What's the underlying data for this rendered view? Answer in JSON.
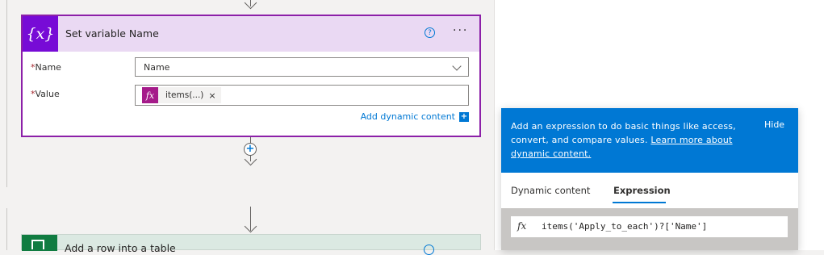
{
  "card": {
    "icon_text": "{x}",
    "title": "Set variable Name",
    "help_icon": "question-circle-icon",
    "more_label": "···",
    "name_label": "Name",
    "name_required": "*",
    "name_value": "Name",
    "value_label": "Value",
    "value_required": "*",
    "token": {
      "icon": "fx",
      "text": "items(...)",
      "remove": "×"
    },
    "add_dynamic_content": "Add dynamic content"
  },
  "next_card": {
    "title": "Add a row into a table"
  },
  "expression_panel": {
    "description": "Add an expression to do basic things like access, convert, and compare values. ",
    "link_text": "Learn more about dynamic content.",
    "hide_label": "Hide",
    "tabs": [
      {
        "label": "Dynamic content",
        "active": false
      },
      {
        "label": "Expression",
        "active": true
      }
    ],
    "fx_label": "fx",
    "expression": "items('Apply_to_each')?['Name']"
  },
  "colors": {
    "accent": "#0078d4",
    "variable_brand": "#770bd6",
    "token_brand": "#a51b8a",
    "excel_brand": "#107c41"
  }
}
